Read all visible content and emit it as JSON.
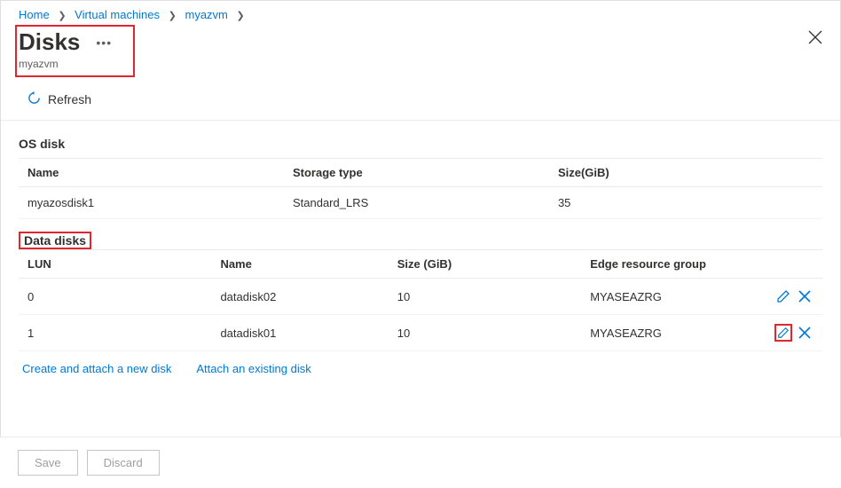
{
  "breadcrumb": [
    {
      "label": "Home"
    },
    {
      "label": "Virtual machines"
    },
    {
      "label": "myazvm"
    }
  ],
  "header": {
    "title": "Disks",
    "subtitle": "myazvm"
  },
  "toolbar": {
    "refresh": "Refresh"
  },
  "os_disk": {
    "heading": "OS disk",
    "columns": {
      "name": "Name",
      "storage": "Storage type",
      "size": "Size(GiB)"
    },
    "row": {
      "name": "myazosdisk1",
      "storage": "Standard_LRS",
      "size": "35"
    }
  },
  "data_disks": {
    "heading": "Data disks",
    "columns": {
      "lun": "LUN",
      "name": "Name",
      "size": "Size (GiB)",
      "erg": "Edge resource group"
    },
    "rows": [
      {
        "lun": "0",
        "name": "datadisk02",
        "size": "10",
        "erg": "MYASEAZRG"
      },
      {
        "lun": "1",
        "name": "datadisk01",
        "size": "10",
        "erg": "MYASEAZRG"
      }
    ]
  },
  "links": {
    "create": "Create and attach a new disk",
    "attach": "Attach an existing disk"
  },
  "footer": {
    "save": "Save",
    "discard": "Discard"
  }
}
